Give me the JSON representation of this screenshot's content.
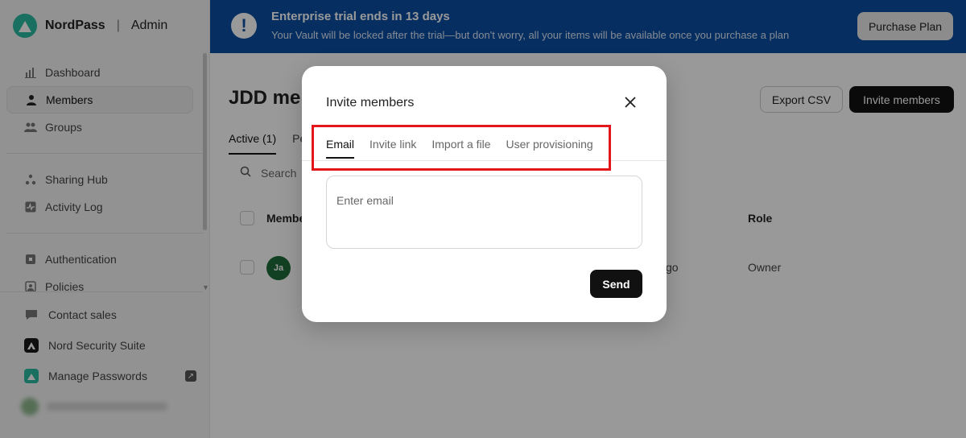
{
  "brand": {
    "name": "NordPass",
    "separator": "|",
    "section": "Admin"
  },
  "sidebar": {
    "primary": [
      {
        "label": "Dashboard",
        "icon": "chart-icon"
      },
      {
        "label": "Members",
        "icon": "person-icon",
        "active": true
      },
      {
        "label": "Groups",
        "icon": "group-icon"
      }
    ],
    "secondary": [
      {
        "label": "Sharing Hub",
        "icon": "share-icon"
      },
      {
        "label": "Activity Log",
        "icon": "activity-icon"
      }
    ],
    "tertiary": [
      {
        "label": "Authentication",
        "icon": "lock-icon"
      },
      {
        "label": "Policies",
        "icon": "policy-icon"
      }
    ],
    "bottom": [
      {
        "label": "Contact sales",
        "icon": "chat-icon"
      },
      {
        "label": "Nord Security Suite",
        "icon": "nord-icon"
      },
      {
        "label": "Manage Passwords",
        "icon": "nordpass-icon"
      }
    ]
  },
  "banner": {
    "title": "Enterprise trial ends in 13 days",
    "subtitle": "Your Vault will be locked after the trial—but don't worry, all your items will be available once you purchase a plan",
    "icon_text": "!",
    "button": "Purchase Plan"
  },
  "main": {
    "title": "JDD mem",
    "export_button": "Export CSV",
    "invite_button": "Invite members",
    "tabs": [
      {
        "label": "Active (1)"
      },
      {
        "label": "Pe"
      }
    ],
    "search_placeholder": "Search",
    "columns": {
      "member": "Member",
      "role": "Role"
    },
    "rows": [
      {
        "avatar": "Ja",
        "tail": "go",
        "role": "Owner"
      }
    ]
  },
  "modal": {
    "title": "Invite members",
    "tabs": [
      {
        "label": "Email",
        "active": true
      },
      {
        "label": "Invite link"
      },
      {
        "label": "Import a file"
      },
      {
        "label": "User provisioning"
      }
    ],
    "email_placeholder": "Enter email",
    "send_button": "Send"
  },
  "colors": {
    "banner": "#0b4ea2",
    "highlight": "#e3161b",
    "brand": "#2bb9a0"
  }
}
